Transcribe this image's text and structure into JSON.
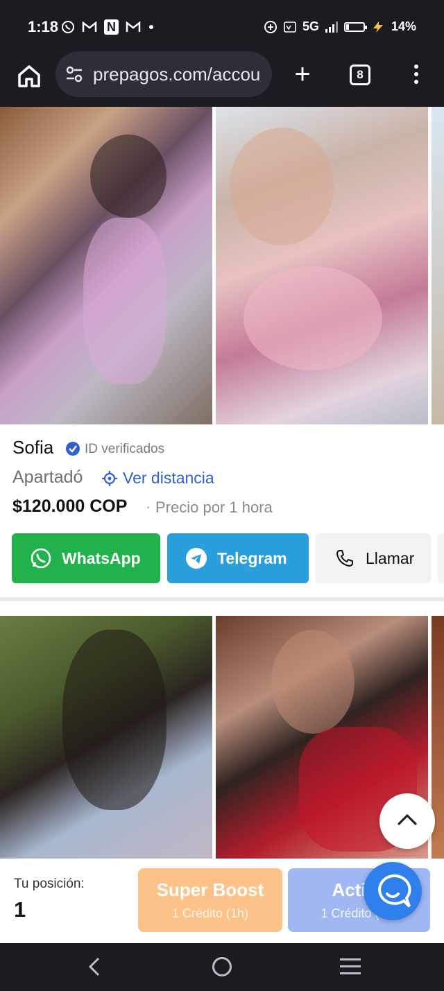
{
  "status_bar": {
    "time": "1:18",
    "notification_icons": [
      "whatsapp-icon",
      "gmail-icon",
      "news-icon",
      "gmail-icon",
      "dot-icon"
    ],
    "right_icons": [
      "add-circle-icon",
      "volte-icon",
      "signal-icon"
    ],
    "network": "5G",
    "battery": "14%"
  },
  "browser": {
    "url": "prepagos.com/accou",
    "tab_count": "8"
  },
  "listing": {
    "name": "Sofia",
    "verified_label": "ID verificados",
    "city": "Apartadó",
    "distance_link": "Ver distancia",
    "price": "$120.000 COP",
    "price_separator": "·",
    "price_note": "Precio por 1 hora",
    "buttons": {
      "whatsapp": "WhatsApp",
      "telegram": "Telegram",
      "call": "Llamar"
    }
  },
  "boost_bar": {
    "position_label": "Tu posición:",
    "position_value": "1",
    "super_boost": {
      "title": "Super Boost",
      "subtitle": "1 Crédito (1h)"
    },
    "activa": {
      "title": "Activa",
      "subtitle": "1 Crédito (2h)"
    }
  },
  "colors": {
    "whatsapp": "#22b24c",
    "telegram": "#2a9fdc",
    "link": "#2f5fd0",
    "super_boost": "#fcc287",
    "activa": "#9fb8f4",
    "chat": "#2f80ed",
    "system_bar": "#1c1b22"
  }
}
